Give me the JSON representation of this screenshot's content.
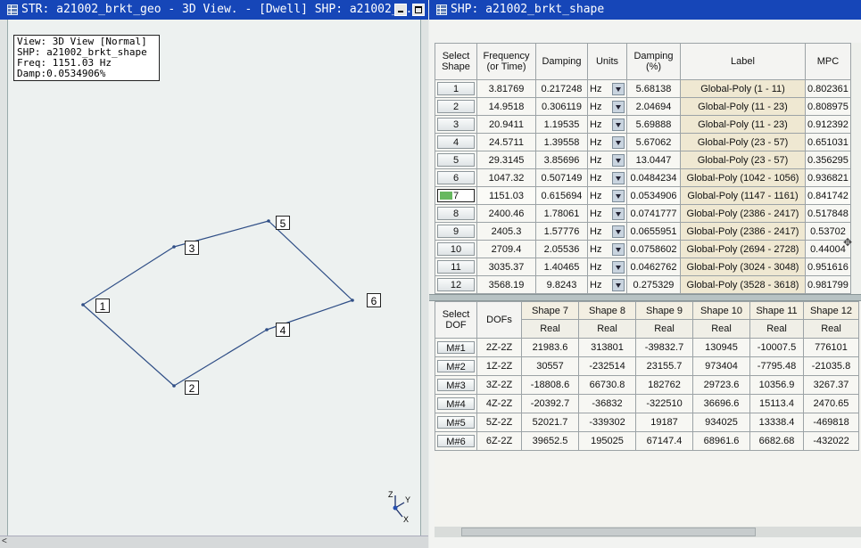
{
  "left_window": {
    "title": "STR: a21002_brkt_geo - 3D View. - [Dwell] SHP: a21002_b...",
    "info": {
      "view": "View: 3D View [Normal]",
      "shp": "SHP: a21002_brkt_shape",
      "freq": "Freq: 1151.03 Hz",
      "damp": "Damp:0.0534906%"
    },
    "nodes": [
      "1",
      "2",
      "3",
      "4",
      "5",
      "6"
    ],
    "axis_triad": {
      "z": "Z",
      "y": "Y",
      "x": "X"
    },
    "scroll_left": "<"
  },
  "right_window": {
    "title": "SHP: a21002_brkt_shape",
    "shape_table": {
      "headers": {
        "select": "Select\nShape",
        "frequency": "Frequency\n(or Time)",
        "damping": "Damping",
        "units": "Units",
        "damping_pct": "Damping\n(%)",
        "label": "Label",
        "mpc": "MPC"
      },
      "rows": [
        {
          "n": "1",
          "freq": "3.81769",
          "damp": "0.217248",
          "units": "Hz",
          "pct": "5.68138",
          "label": "Global-Poly (1 - 11)",
          "mpc": "0.802361"
        },
        {
          "n": "2",
          "freq": "14.9518",
          "damp": "0.306119",
          "units": "Hz",
          "pct": "2.04694",
          "label": "Global-Poly (11 - 23)",
          "mpc": "0.808975"
        },
        {
          "n": "3",
          "freq": "20.9411",
          "damp": "1.19535",
          "units": "Hz",
          "pct": "5.69888",
          "label": "Global-Poly (11 - 23)",
          "mpc": "0.912392"
        },
        {
          "n": "4",
          "freq": "24.5711",
          "damp": "1.39558",
          "units": "Hz",
          "pct": "5.67062",
          "label": "Global-Poly (23 - 57)",
          "mpc": "0.651031"
        },
        {
          "n": "5",
          "freq": "29.3145",
          "damp": "3.85696",
          "units": "Hz",
          "pct": "13.0447",
          "label": "Global-Poly (23 - 57)",
          "mpc": "0.356295"
        },
        {
          "n": "6",
          "freq": "1047.32",
          "damp": "0.507149",
          "units": "Hz",
          "pct": "0.0484234",
          "label": "Global-Poly (1042 - 1056)",
          "mpc": "0.936821"
        },
        {
          "n": "7",
          "freq": "1151.03",
          "damp": "0.615694",
          "units": "Hz",
          "pct": "0.0534906",
          "label": "Global-Poly (1147 - 1161)",
          "mpc": "0.841742"
        },
        {
          "n": "8",
          "freq": "2400.46",
          "damp": "1.78061",
          "units": "Hz",
          "pct": "0.0741777",
          "label": "Global-Poly (2386 - 2417)",
          "mpc": "0.517848"
        },
        {
          "n": "9",
          "freq": "2405.3",
          "damp": "1.57776",
          "units": "Hz",
          "pct": "0.0655951",
          "label": "Global-Poly (2386 - 2417)",
          "mpc": "0.53702"
        },
        {
          "n": "10",
          "freq": "2709.4",
          "damp": "2.05536",
          "units": "Hz",
          "pct": "0.0758602",
          "label": "Global-Poly (2694 - 2728)",
          "mpc": "0.44004"
        },
        {
          "n": "11",
          "freq": "3035.37",
          "damp": "1.40465",
          "units": "Hz",
          "pct": "0.0462762",
          "label": "Global-Poly (3024 - 3048)",
          "mpc": "0.951616"
        },
        {
          "n": "12",
          "freq": "3568.19",
          "damp": "9.8243",
          "units": "Hz",
          "pct": "0.275329",
          "label": "Global-Poly (3528 - 3618)",
          "mpc": "0.981799"
        }
      ],
      "selected_row": "7"
    },
    "dof_table": {
      "select_header": "Select\nDOF",
      "dofs_header": "DOFs",
      "shapes": [
        "Shape 7",
        "Shape 8",
        "Shape 9",
        "Shape 10",
        "Shape 11",
        "Shape 12"
      ],
      "sub_header": "Real",
      "rows": [
        {
          "m": "M#1",
          "dof": "2Z-2Z",
          "vals": [
            "21983.6",
            "313801",
            "-39832.7",
            "130945",
            "-10007.5",
            "776101"
          ]
        },
        {
          "m": "M#2",
          "dof": "1Z-2Z",
          "vals": [
            "30557",
            "-232514",
            "23155.7",
            "973404",
            "-7795.48",
            "-21035.8"
          ]
        },
        {
          "m": "M#3",
          "dof": "3Z-2Z",
          "vals": [
            "-18808.6",
            "66730.8",
            "182762",
            "29723.6",
            "10356.9",
            "3267.37"
          ]
        },
        {
          "m": "M#4",
          "dof": "4Z-2Z",
          "vals": [
            "-20392.7",
            "-36832",
            "-322510",
            "36696.6",
            "15113.4",
            "2470.65"
          ]
        },
        {
          "m": "M#5",
          "dof": "5Z-2Z",
          "vals": [
            "52021.7",
            "-339302",
            "19187",
            "934025",
            "13338.4",
            "-469818"
          ]
        },
        {
          "m": "M#6",
          "dof": "6Z-2Z",
          "vals": [
            "39652.5",
            "195025",
            "67147.4",
            "68961.6",
            "6682.68",
            "-432022"
          ]
        }
      ]
    }
  },
  "colors": {
    "titlebar": "#1646b8",
    "model_line": "#2f4e86",
    "label_cell": "#efe8d2",
    "selected_indicator": "#67b85f"
  }
}
